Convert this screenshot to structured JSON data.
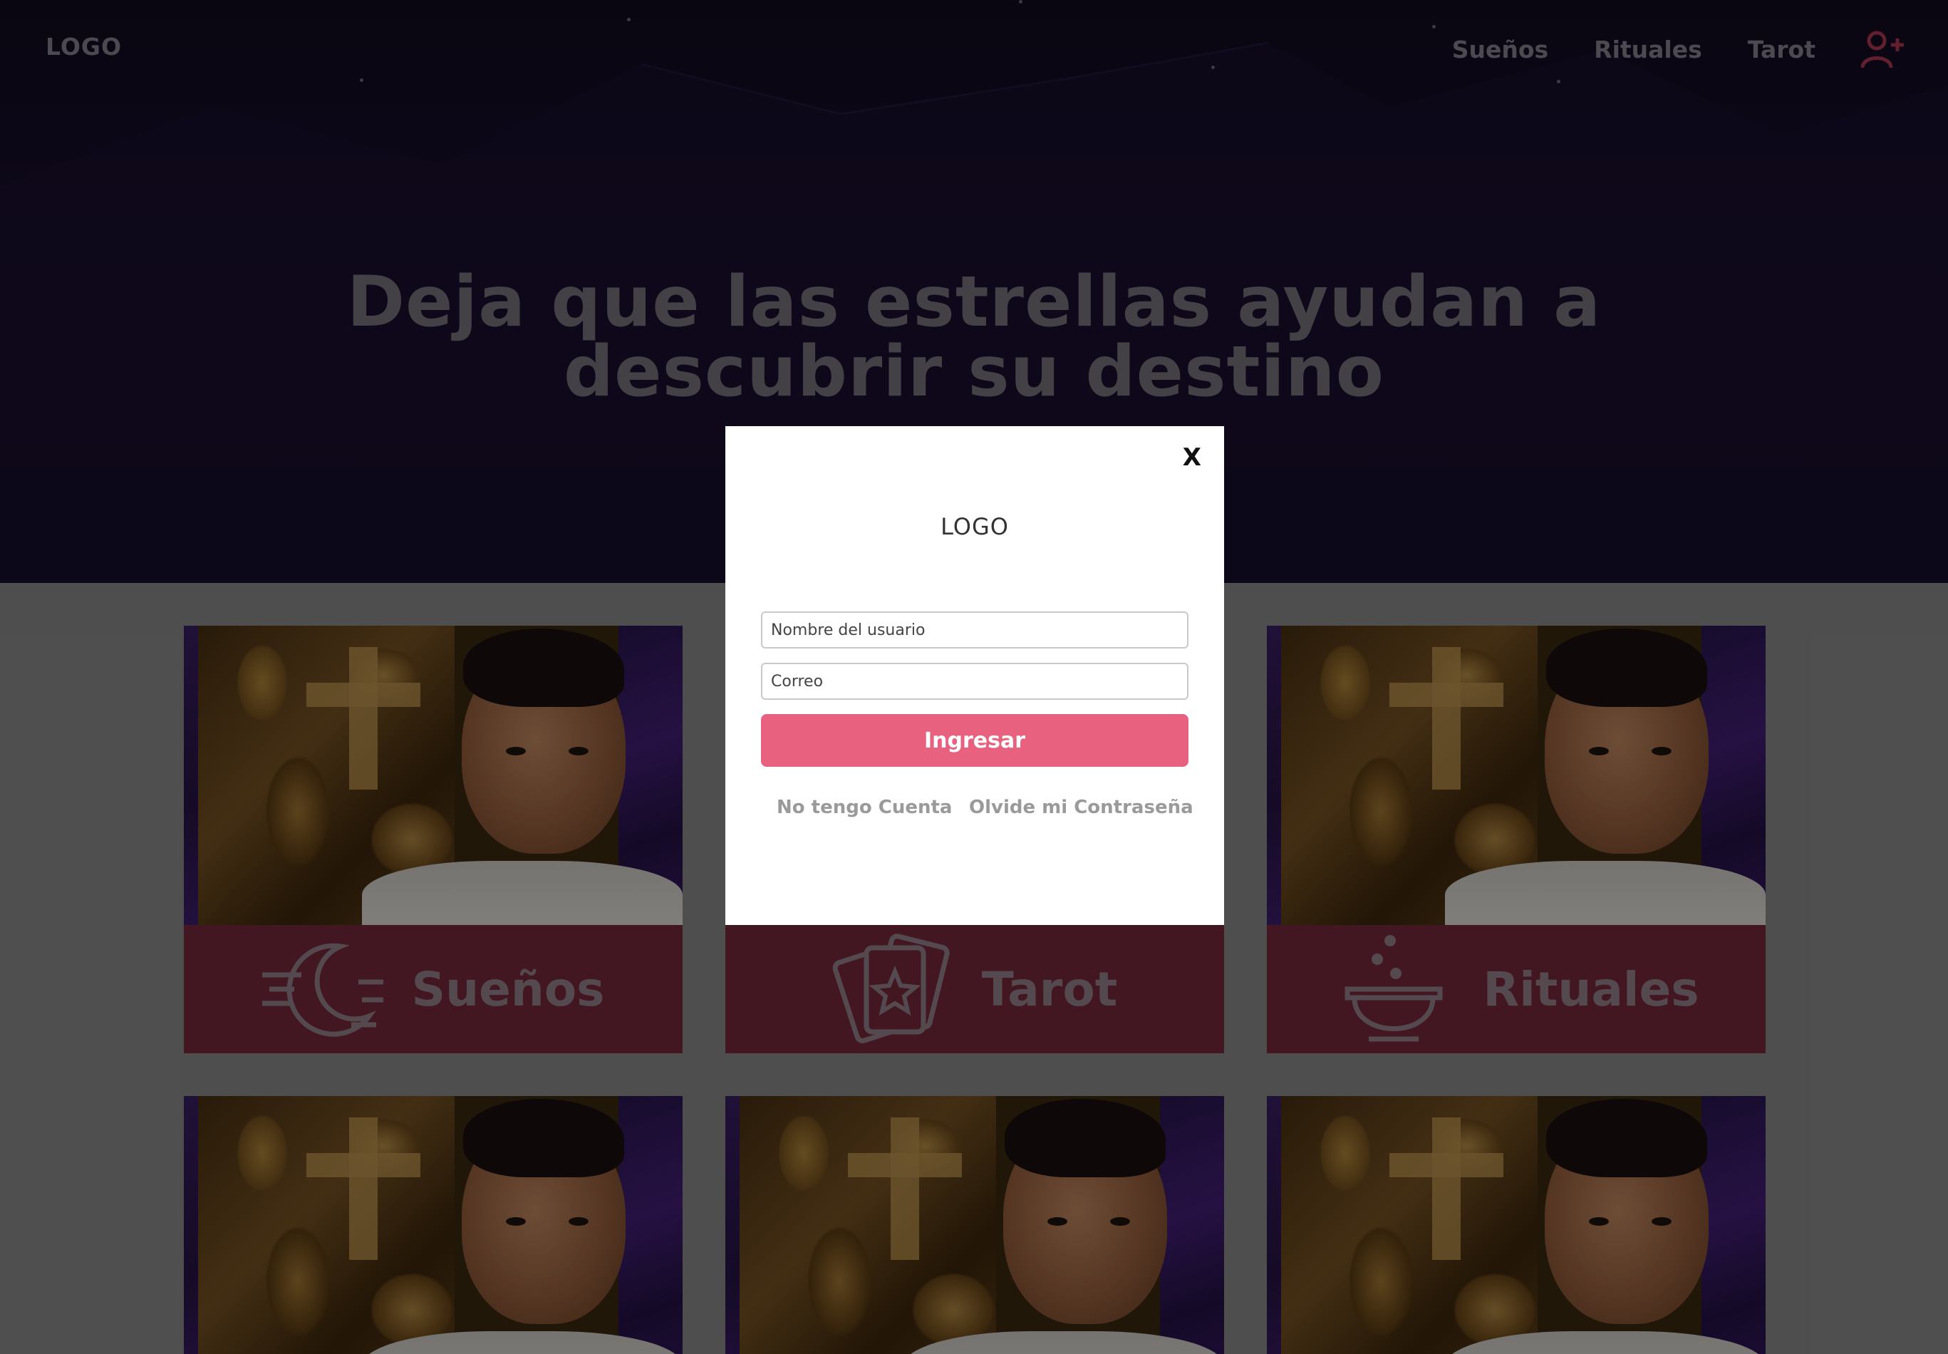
{
  "header": {
    "logo": "LOGO",
    "nav": [
      "Sueños",
      "Rituales",
      "Tarot"
    ],
    "user_icon": "user-add-icon",
    "user_icon_color": "#b33a52"
  },
  "hero": {
    "title_line1": "Deja que las estrellas ayudan a",
    "title_line2": "descubrir su destino"
  },
  "cards": [
    {
      "label": "Sueños",
      "icon": "moon-icon"
    },
    {
      "label": "Tarot",
      "icon": "tarot-cards-icon"
    },
    {
      "label": "Rituales",
      "icon": "cauldron-icon"
    },
    {
      "label": "",
      "icon": ""
    },
    {
      "label": "",
      "icon": ""
    },
    {
      "label": "",
      "icon": ""
    }
  ],
  "modal": {
    "close_label": "X",
    "logo": "LOGO",
    "username_placeholder": "Nombre del usuario",
    "email_placeholder": "Correo",
    "submit_label": "Ingresar",
    "no_account_label": "No tengo Cuenta",
    "forgot_label": "Olvide mi Contraseña"
  },
  "colors": {
    "hero_bg": "#160c2a",
    "card_band": "#7a2a3d",
    "accent": "#e8617f",
    "page_bg": "#8f8f8f"
  }
}
